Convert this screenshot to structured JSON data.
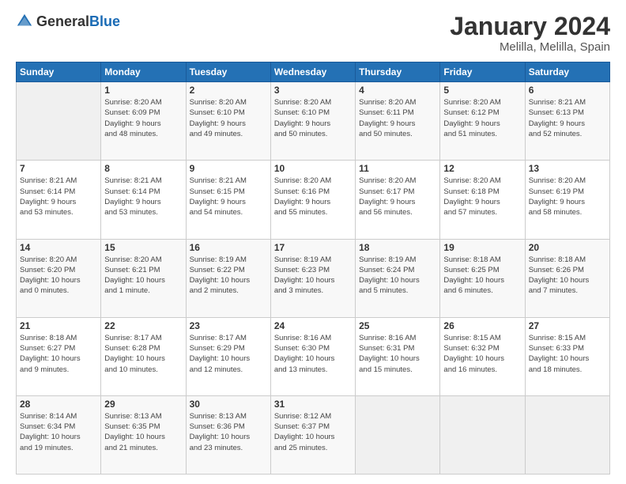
{
  "header": {
    "logo": {
      "text_general": "General",
      "text_blue": "Blue"
    },
    "title": "January 2024",
    "location": "Melilla, Melilla, Spain"
  },
  "calendar": {
    "days_of_week": [
      "Sunday",
      "Monday",
      "Tuesday",
      "Wednesday",
      "Thursday",
      "Friday",
      "Saturday"
    ],
    "weeks": [
      [
        {
          "day": "",
          "info": ""
        },
        {
          "day": "1",
          "info": "Sunrise: 8:20 AM\nSunset: 6:09 PM\nDaylight: 9 hours\nand 48 minutes."
        },
        {
          "day": "2",
          "info": "Sunrise: 8:20 AM\nSunset: 6:10 PM\nDaylight: 9 hours\nand 49 minutes."
        },
        {
          "day": "3",
          "info": "Sunrise: 8:20 AM\nSunset: 6:10 PM\nDaylight: 9 hours\nand 50 minutes."
        },
        {
          "day": "4",
          "info": "Sunrise: 8:20 AM\nSunset: 6:11 PM\nDaylight: 9 hours\nand 50 minutes."
        },
        {
          "day": "5",
          "info": "Sunrise: 8:20 AM\nSunset: 6:12 PM\nDaylight: 9 hours\nand 51 minutes."
        },
        {
          "day": "6",
          "info": "Sunrise: 8:21 AM\nSunset: 6:13 PM\nDaylight: 9 hours\nand 52 minutes."
        }
      ],
      [
        {
          "day": "7",
          "info": "Sunrise: 8:21 AM\nSunset: 6:14 PM\nDaylight: 9 hours\nand 53 minutes."
        },
        {
          "day": "8",
          "info": "Sunrise: 8:21 AM\nSunset: 6:14 PM\nDaylight: 9 hours\nand 53 minutes."
        },
        {
          "day": "9",
          "info": "Sunrise: 8:21 AM\nSunset: 6:15 PM\nDaylight: 9 hours\nand 54 minutes."
        },
        {
          "day": "10",
          "info": "Sunrise: 8:20 AM\nSunset: 6:16 PM\nDaylight: 9 hours\nand 55 minutes."
        },
        {
          "day": "11",
          "info": "Sunrise: 8:20 AM\nSunset: 6:17 PM\nDaylight: 9 hours\nand 56 minutes."
        },
        {
          "day": "12",
          "info": "Sunrise: 8:20 AM\nSunset: 6:18 PM\nDaylight: 9 hours\nand 57 minutes."
        },
        {
          "day": "13",
          "info": "Sunrise: 8:20 AM\nSunset: 6:19 PM\nDaylight: 9 hours\nand 58 minutes."
        }
      ],
      [
        {
          "day": "14",
          "info": "Sunrise: 8:20 AM\nSunset: 6:20 PM\nDaylight: 10 hours\nand 0 minutes."
        },
        {
          "day": "15",
          "info": "Sunrise: 8:20 AM\nSunset: 6:21 PM\nDaylight: 10 hours\nand 1 minute."
        },
        {
          "day": "16",
          "info": "Sunrise: 8:19 AM\nSunset: 6:22 PM\nDaylight: 10 hours\nand 2 minutes."
        },
        {
          "day": "17",
          "info": "Sunrise: 8:19 AM\nSunset: 6:23 PM\nDaylight: 10 hours\nand 3 minutes."
        },
        {
          "day": "18",
          "info": "Sunrise: 8:19 AM\nSunset: 6:24 PM\nDaylight: 10 hours\nand 5 minutes."
        },
        {
          "day": "19",
          "info": "Sunrise: 8:18 AM\nSunset: 6:25 PM\nDaylight: 10 hours\nand 6 minutes."
        },
        {
          "day": "20",
          "info": "Sunrise: 8:18 AM\nSunset: 6:26 PM\nDaylight: 10 hours\nand 7 minutes."
        }
      ],
      [
        {
          "day": "21",
          "info": "Sunrise: 8:18 AM\nSunset: 6:27 PM\nDaylight: 10 hours\nand 9 minutes."
        },
        {
          "day": "22",
          "info": "Sunrise: 8:17 AM\nSunset: 6:28 PM\nDaylight: 10 hours\nand 10 minutes."
        },
        {
          "day": "23",
          "info": "Sunrise: 8:17 AM\nSunset: 6:29 PM\nDaylight: 10 hours\nand 12 minutes."
        },
        {
          "day": "24",
          "info": "Sunrise: 8:16 AM\nSunset: 6:30 PM\nDaylight: 10 hours\nand 13 minutes."
        },
        {
          "day": "25",
          "info": "Sunrise: 8:16 AM\nSunset: 6:31 PM\nDaylight: 10 hours\nand 15 minutes."
        },
        {
          "day": "26",
          "info": "Sunrise: 8:15 AM\nSunset: 6:32 PM\nDaylight: 10 hours\nand 16 minutes."
        },
        {
          "day": "27",
          "info": "Sunrise: 8:15 AM\nSunset: 6:33 PM\nDaylight: 10 hours\nand 18 minutes."
        }
      ],
      [
        {
          "day": "28",
          "info": "Sunrise: 8:14 AM\nSunset: 6:34 PM\nDaylight: 10 hours\nand 19 minutes."
        },
        {
          "day": "29",
          "info": "Sunrise: 8:13 AM\nSunset: 6:35 PM\nDaylight: 10 hours\nand 21 minutes."
        },
        {
          "day": "30",
          "info": "Sunrise: 8:13 AM\nSunset: 6:36 PM\nDaylight: 10 hours\nand 23 minutes."
        },
        {
          "day": "31",
          "info": "Sunrise: 8:12 AM\nSunset: 6:37 PM\nDaylight: 10 hours\nand 25 minutes."
        },
        {
          "day": "",
          "info": ""
        },
        {
          "day": "",
          "info": ""
        },
        {
          "day": "",
          "info": ""
        }
      ]
    ]
  }
}
